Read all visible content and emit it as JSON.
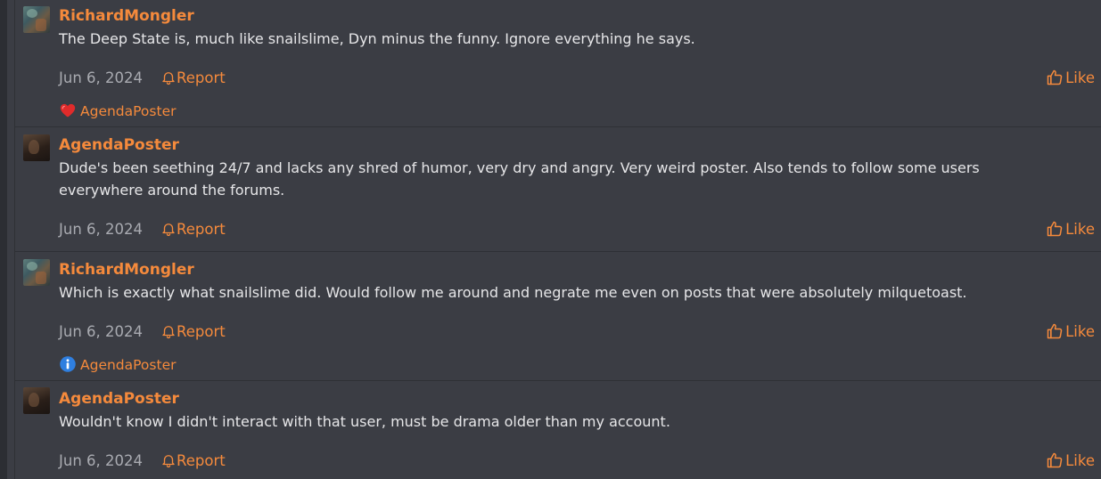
{
  "posts": [
    {
      "username": "RichardMongler",
      "avatar": "RichardMongler avatar",
      "text": "The Deep State is, much like snailslime, Dyn minus the funny. Ignore everything he says.",
      "date": "Jun 6, 2024",
      "report_label": "Report",
      "like_label": "Like",
      "reaction": {
        "icon": "heart-icon",
        "user": "AgendaPoster",
        "color": "#e02b2b"
      }
    },
    {
      "username": "AgendaPoster",
      "avatar": "AgendaPoster avatar",
      "text": "Dude's been seething 24/7 and lacks any shred of humor, very dry and angry. Very weird poster. Also tends to follow some users everywhere around the forums.",
      "date": "Jun 6, 2024",
      "report_label": "Report",
      "like_label": "Like"
    },
    {
      "username": "RichardMongler",
      "avatar": "RichardMongler avatar",
      "text": "Which is exactly what snailslime did. Would follow me around and negrate me even on posts that were absolutely milquetoast.",
      "date": "Jun 6, 2024",
      "report_label": "Report",
      "like_label": "Like",
      "reaction": {
        "icon": "info-icon",
        "user": "AgendaPoster",
        "color": "#2f7fe0"
      }
    },
    {
      "username": "AgendaPoster",
      "avatar": "AgendaPoster avatar",
      "text": "Wouldn't know I didn't interact with that user, must be drama older than my account.",
      "date": "Jun 6, 2024",
      "report_label": "Report",
      "like_label": "Like"
    }
  ],
  "colors": {
    "background": "#3b3d44",
    "accent": "#f58a3c",
    "text": "#e6e6e8",
    "muted": "#a9abb1"
  }
}
